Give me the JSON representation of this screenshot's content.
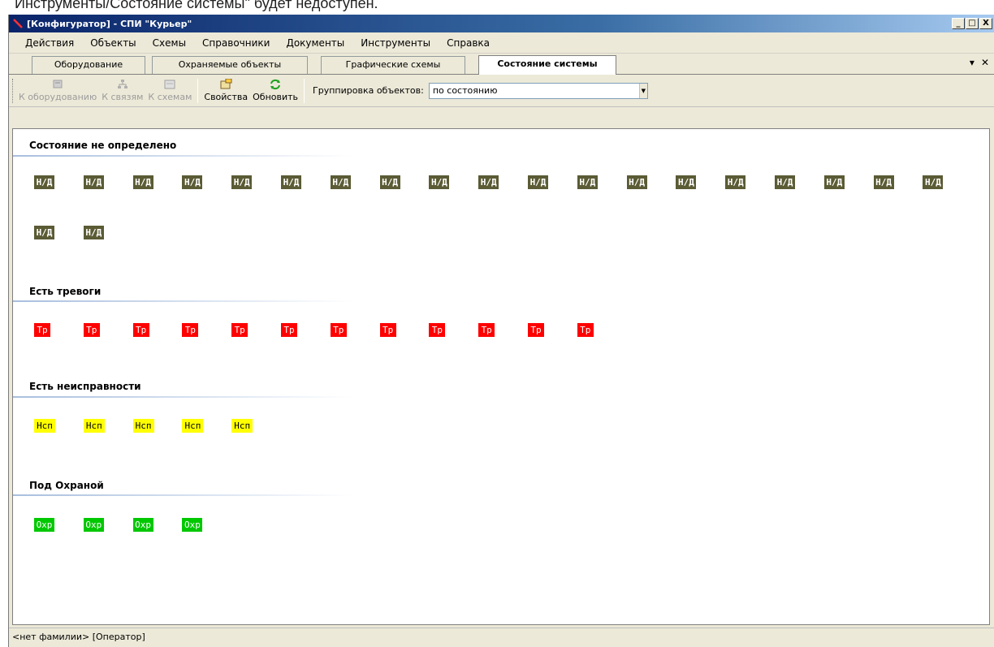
{
  "caption": "Инструменты/Состояние системы\" будет недоступен.",
  "window": {
    "title": "[Конфигуратор] - СПИ \"Курьер\"",
    "buttons": [
      "_",
      "□",
      "X"
    ]
  },
  "menu": [
    "Действия",
    "Объекты",
    "Схемы",
    "Справочники",
    "Документы",
    "Инструменты",
    "Справка"
  ],
  "tabs": [
    {
      "label": "Оборудование",
      "active": false
    },
    {
      "label": "Охраняемые объекты",
      "active": false
    },
    {
      "label": "Графические схемы",
      "active": false
    },
    {
      "label": "Состояние системы",
      "active": true
    }
  ],
  "tab_controls": {
    "dropdown": "▾",
    "close": "✕"
  },
  "toolbar": {
    "buttons": [
      {
        "label": "К оборудованию",
        "icon": "hardware-icon",
        "enabled": false
      },
      {
        "label": "К связям",
        "icon": "links-icon",
        "enabled": false
      },
      {
        "label": "К схемам",
        "icon": "schema-icon",
        "enabled": false
      },
      {
        "label": "Свойства",
        "icon": "properties-icon",
        "enabled": true
      },
      {
        "label": "Обновить",
        "icon": "refresh-icon",
        "enabled": true
      }
    ],
    "grouping_label": "Группировка объектов:",
    "grouping_value": "по состоянию"
  },
  "sections": [
    {
      "title": "Состояние не определено",
      "badge": "Н/Д",
      "count": 21,
      "kind": "nd"
    },
    {
      "title": "Есть тревоги",
      "badge": "Тр",
      "count": 12,
      "kind": "tr"
    },
    {
      "title": "Есть неисправности",
      "badge": "Нсп",
      "count": 5,
      "kind": "nsp"
    },
    {
      "title": "Под Охраной",
      "badge": "Охр",
      "count": 4,
      "kind": "ohr"
    }
  ],
  "status": "<нет фамилии> [Оператор]",
  "colors": {
    "nd": "#5b5b35",
    "tr": "#ff0000",
    "nsp": "#ffff00",
    "ohr": "#00c800"
  }
}
